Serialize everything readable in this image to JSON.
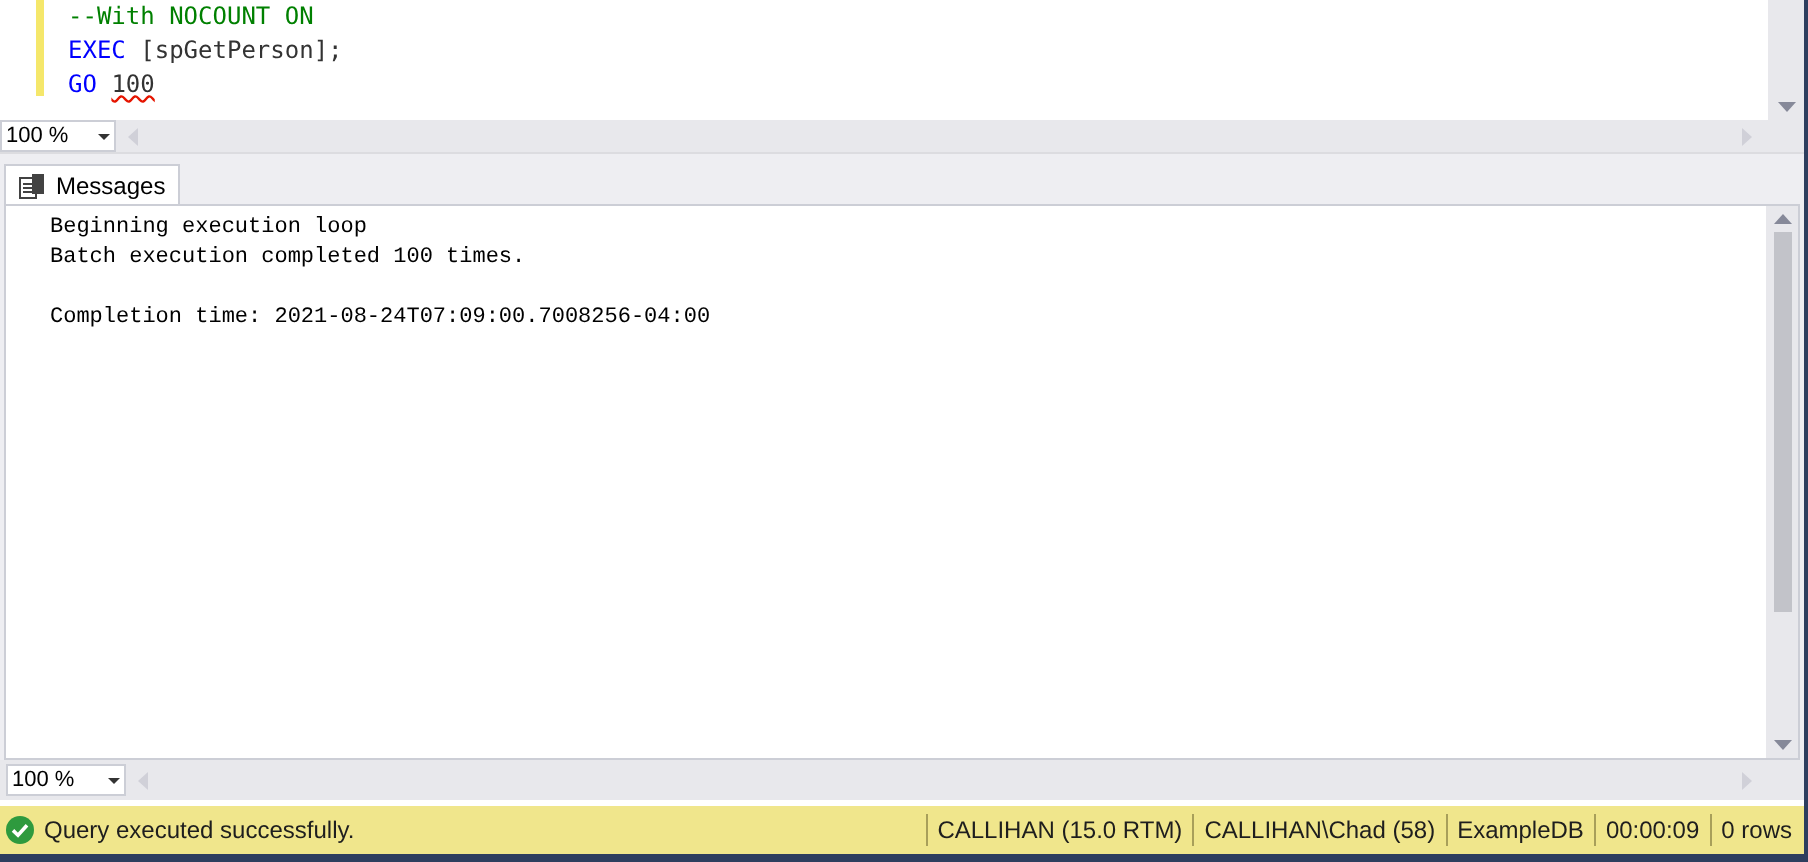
{
  "editor": {
    "lines": [
      [
        {
          "kind": "comment",
          "text": "--With NOCOUNT ON",
          "error": false
        }
      ],
      [
        {
          "kind": "keyword",
          "text": "EXEC",
          "error": false
        },
        {
          "kind": "plain",
          "text": " [spGetPerson];",
          "error": false
        }
      ],
      [
        {
          "kind": "keyword",
          "text": "GO ",
          "error": false
        },
        {
          "kind": "plain",
          "text": "100",
          "error": true
        }
      ]
    ],
    "zoom": "100 %"
  },
  "results": {
    "tabs": [
      {
        "label": "Messages",
        "selected": true
      }
    ],
    "message_blocks": [
      [
        "Beginning execution loop",
        "Batch execution completed 100 times."
      ],
      [
        "Completion time: 2021-08-24T07:09:00.7008256-04:00"
      ]
    ],
    "zoom": "100 %"
  },
  "status_bar": {
    "message": "Query executed successfully.",
    "fields": [
      "CALLIHAN (15.0 RTM)",
      "CALLIHAN\\Chad (58)",
      "ExampleDB",
      "00:00:09",
      "0 rows"
    ]
  }
}
